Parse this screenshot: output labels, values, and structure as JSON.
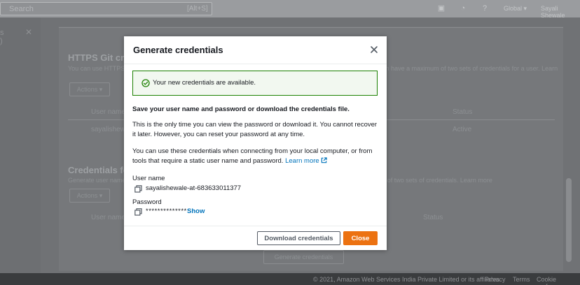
{
  "topbar": {
    "search_text": "Search",
    "search_shortcut": "[Alt+S]",
    "region": "Global ▾",
    "user": "Sayali Shewale"
  },
  "sidebar": {
    "line1": "s",
    "line2": ")"
  },
  "background": {
    "https_heading": "HTTPS Git cred",
    "https_desc": "You can use HTTPS Git credentials to authenticate HTTPS connections to AWS CodeCommit repositories. You can have a maximum of two sets of credentials for a user. Learn more",
    "actions_label": "Actions ▾",
    "col_username": "User name",
    "col_status": "Status",
    "row_user": "sayalishewale",
    "row_status": "Active",
    "credentials_heading": "Credentials for",
    "credentials_desc": "Generate user name and password you can use to authenticate to Amazon Keyspaces. You can have a maximum of two sets of credentials. Learn more",
    "actions2_label": "Actions ▾",
    "col_username2": "User name",
    "col_status2": "Status",
    "generate_button": "Generate credentials"
  },
  "footer": {
    "copyright": "© 2021, Amazon Web Services India Private Limited or its affiliates.",
    "privacy": "Privacy",
    "terms": "Terms",
    "cookie": "Cookie preferences"
  },
  "modal": {
    "title": "Generate credentials",
    "alert_text": "Your new credentials are available.",
    "instruction_bold": "Save your user name and password or download the credentials file.",
    "paragraph1": "This is the only time you can view the password or download it. You cannot recover it later. However, you can reset your password at any time.",
    "paragraph2": "You can use these credentials when connecting from your local computer, or from tools that require a static user name and password.",
    "learn_more": "Learn more",
    "username_label": "User name",
    "username_value": "sayalishewale-at-683633011377",
    "password_label": "Password",
    "password_value": "**************",
    "show_label": "Show",
    "download_button": "Download credentials",
    "close_button": "Close"
  },
  "colors": {
    "accent_orange": "#ec7211",
    "link_blue": "#0073bb",
    "success_green": "#1d8102"
  },
  "icons": {
    "close": "close-icon",
    "success": "check-circle-icon",
    "external_link": "external-link-icon",
    "copy": "copy-icon"
  }
}
